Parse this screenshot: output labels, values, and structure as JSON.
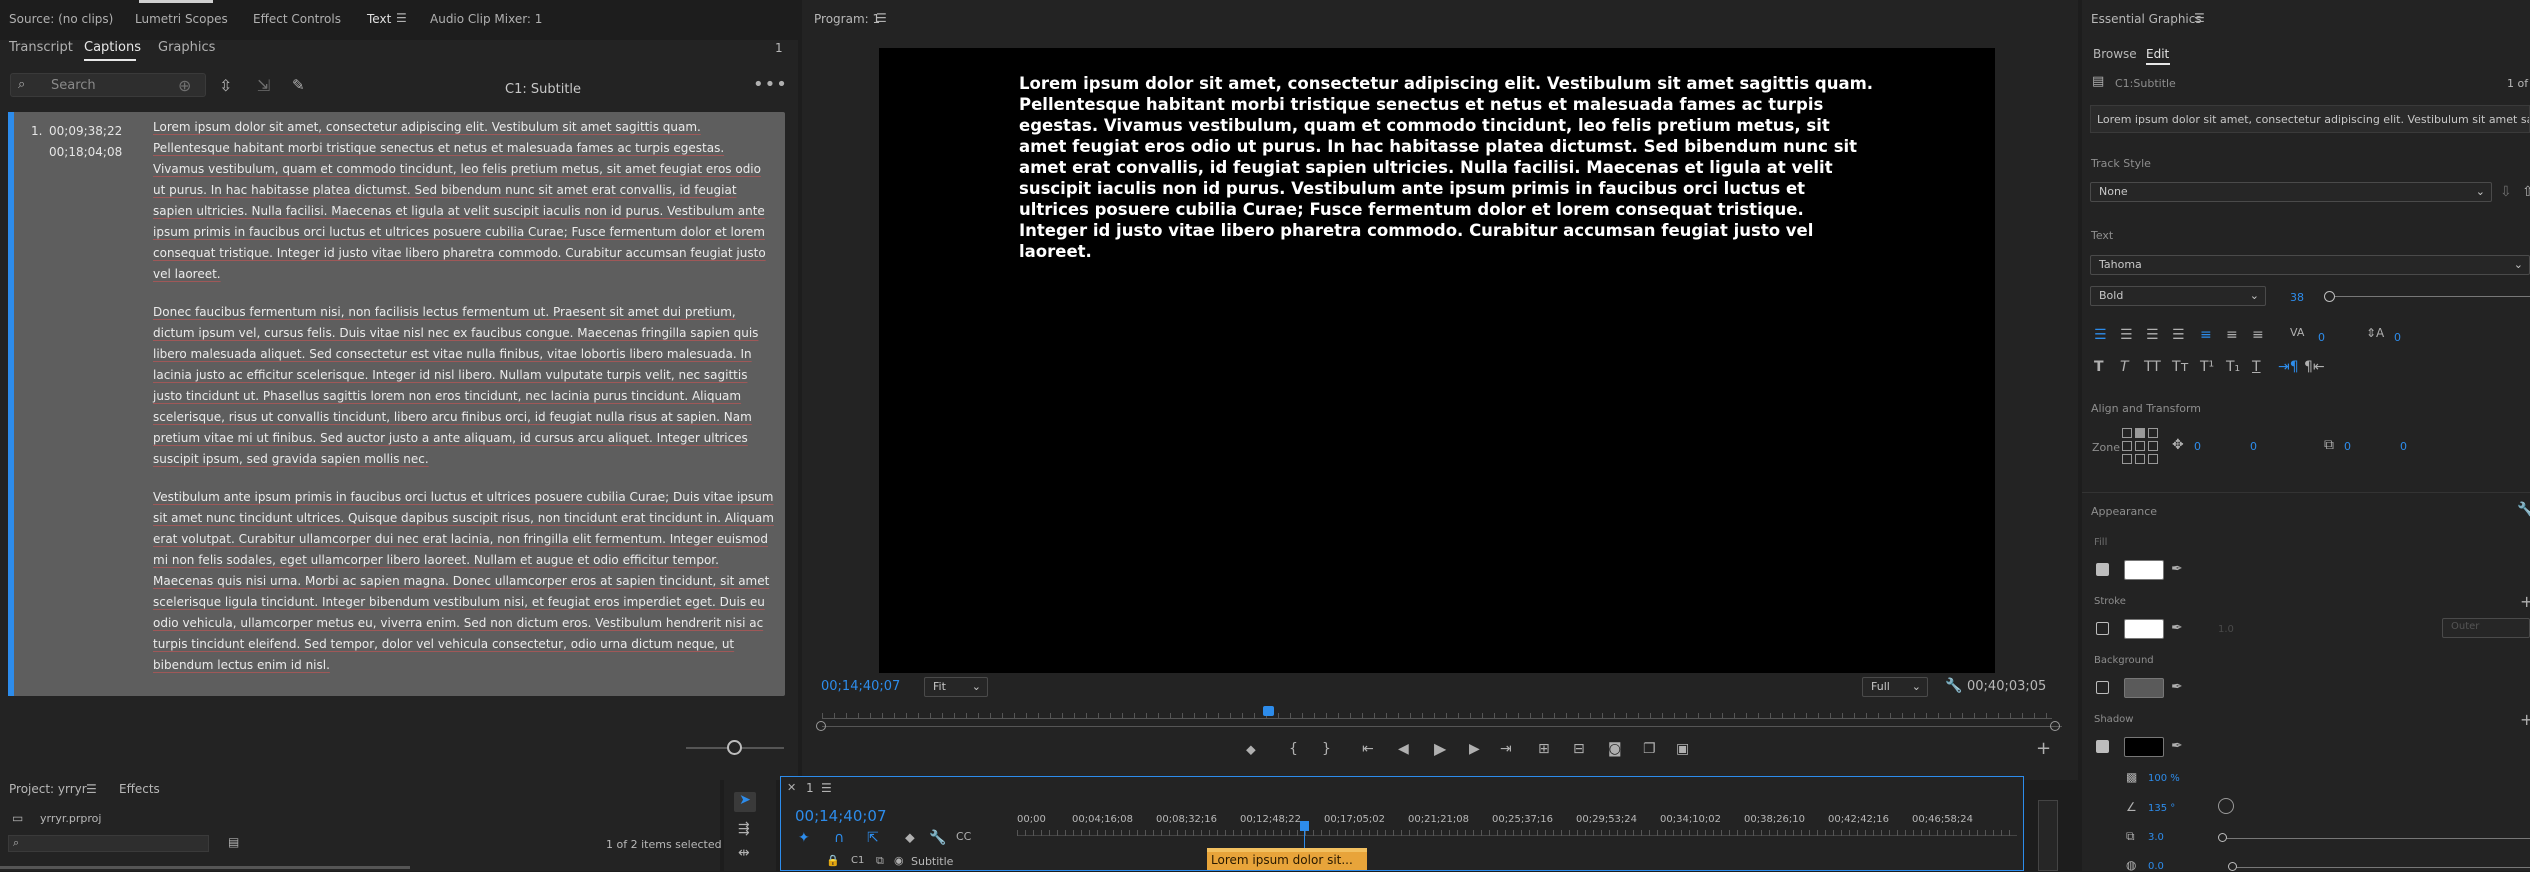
{
  "top_tabs": {
    "source": "Source: (no clips)",
    "lumetri": "Lumetri Scopes",
    "effect_controls": "Effect Controls",
    "text": "Text",
    "mixer": "Audio Clip Mixer: 1"
  },
  "text_panel": {
    "tabs": [
      "Transcript",
      "Captions",
      "Graphics"
    ],
    "count": "1",
    "search_placeholder": "Search",
    "track_name": "C1: Subtitle",
    "slider_label": ""
  },
  "caption": {
    "index": "1.",
    "in": "00;09;38;22",
    "out": "00;18;04;08",
    "p1": "Lorem ipsum dolor sit amet, consectetur adipiscing elit. Vestibulum sit amet sagittis quam. Pellentesque habitant morbi tristique senectus et netus et malesuada fames ac turpis egestas. Vivamus vestibulum, quam et commodo tincidunt, leo felis pretium metus, sit amet feugiat eros odio ut purus. In hac habitasse platea dictumst. Sed bibendum nunc sit amet erat convallis, id feugiat sapien ultricies. Nulla facilisi. Maecenas et ligula at velit suscipit iaculis non id purus. Vestibulum ante ipsum primis in faucibus orci luctus et ultrices posuere cubilia Curae; Fusce fermentum dolor et lorem consequat tristique. Integer id justo vitae libero pharetra commodo. Curabitur accumsan feugiat justo vel laoreet.",
    "p2": "Donec faucibus fermentum nisi, non facilisis lectus fermentum ut. Praesent sit amet dui pretium, dictum ipsum vel, cursus felis. Duis vitae nisl nec ex faucibus congue. Maecenas fringilla sapien quis libero malesuada aliquet. Sed consectetur est vitae nulla finibus, vitae lobortis libero malesuada. In lacinia justo ac efficitur scelerisque. Integer id nisl libero. Nullam vulputate turpis velit, nec sagittis justo tincidunt ut. Phasellus sagittis lorem non eros tincidunt, nec lacinia purus tincidunt. Aliquam scelerisque, risus ut convallis tincidunt, libero arcu finibus orci, id feugiat nulla risus at sapien. Nam pretium vitae mi ut finibus. Sed auctor justo a ante aliquam, id cursus arcu aliquet. Integer ultrices suscipit ipsum, sed gravida sapien mollis nec.",
    "p3": "Vestibulum ante ipsum primis in faucibus orci luctus et ultrices posuere cubilia Curae; Duis vitae ipsum sit amet nunc tincidunt ultrices. Quisque dapibus suscipit risus, non tincidunt erat tincidunt in. Aliquam erat volutpat. Curabitur ullamcorper dui nec erat lacinia, non fringilla elit fermentum. Integer euismod mi non felis sodales, eget ullamcorper libero laoreet. Nullam et augue et odio efficitur tempor. Maecenas quis nisi urna. Morbi ac sapien magna. Donec ullamcorper eros at sapien tincidunt, sit amet scelerisque ligula tincidunt. Integer bibendum vestibulum nisi, et feugiat eros imperdiet eget. Duis eu odio vehicula, ullamcorper metus eu, viverra enim. Sed non dictum eros. Vestibulum hendrerit nisi ac turpis tincidunt eleifend. Sed tempor, dolor vel vehicula consectetur, odio urna dictum neque, ut bibendum lectus enim id nisl."
  },
  "program": {
    "title": "Program: 1",
    "overlay": "Lorem ipsum dolor sit amet, consectetur adipiscing elit. Vestibulum sit amet sagittis quam. Pellentesque habitant morbi tristique senectus et netus et malesuada fames ac turpis egestas. Vivamus vestibulum, quam et commodo tincidunt, leo felis pretium metus, sit amet feugiat eros odio ut purus. In hac habitasse platea dictumst. Sed bibendum nunc sit amet erat convallis, id feugiat sapien ultricies. Nulla facilisi. Maecenas et ligula at velit suscipit iaculis non id purus. Vestibulum ante ipsum primis in faucibus orci luctus et ultrices posuere cubilia Curae; Fusce fermentum dolor et lorem consequat tristique. Integer id justo vitae libero pharetra commodo. Curabitur accumsan feugiat justo vel laoreet.",
    "timecode": "00;14;40;07",
    "fit": "Fit",
    "quality": "Full",
    "duration": "00;40;03;05"
  },
  "project": {
    "title": "Project: yrryr",
    "effects": "Effects",
    "file": "yrryr.prproj",
    "selected": "1 of 2 items selected"
  },
  "timeline": {
    "tab": "1",
    "timecode": "00;14;40;07",
    "ruler": [
      "00;00",
      "00;04;16;08",
      "00;08;32;16",
      "00;12;48;22",
      "00;17;05;02",
      "00;21;21;08",
      "00;25;37;16",
      "00;29;53;24",
      "00;34;10;02",
      "00;38;26;10",
      "00;42;42;16",
      "00;46;58;24"
    ],
    "track": "Subtitle",
    "track_id": "C1",
    "clip": "Lorem ipsum dolor sit..."
  },
  "eg": {
    "title": "Essential Graphics",
    "tabs": [
      "Browse",
      "Edit"
    ],
    "layer": "C1:Subtitle",
    "count": "1 of",
    "preview": "Lorem ipsum dolor sit amet, consectetur adipiscing elit. Vestibulum sit amet sagittis qu...",
    "track_style_label": "Track Style",
    "track_style": "None",
    "text_label": "Text",
    "font": "Tahoma",
    "weight": "Bold",
    "size": "38",
    "tracking": "0",
    "leading": "0",
    "align_label": "Align and Transform",
    "zone_label": "Zone",
    "pos_x": "0",
    "pos_y": "0",
    "scale_x": "0",
    "scale_y": "0",
    "appearance": "Appearance",
    "fill": "Fill",
    "stroke": "Stroke",
    "stroke_w": "1.0",
    "stroke_type": "Outer",
    "background": "Background",
    "shadow": "Shadow",
    "opacity": "100 %",
    "angle": "135 °",
    "distance": "3.0",
    "blur": "0.0",
    "fill_color": "#ffffff",
    "stroke_color": "#ffffff",
    "bg_color": "#5a5a5a",
    "shadow_color": "#000000",
    "accent": "#2d8ceb"
  }
}
